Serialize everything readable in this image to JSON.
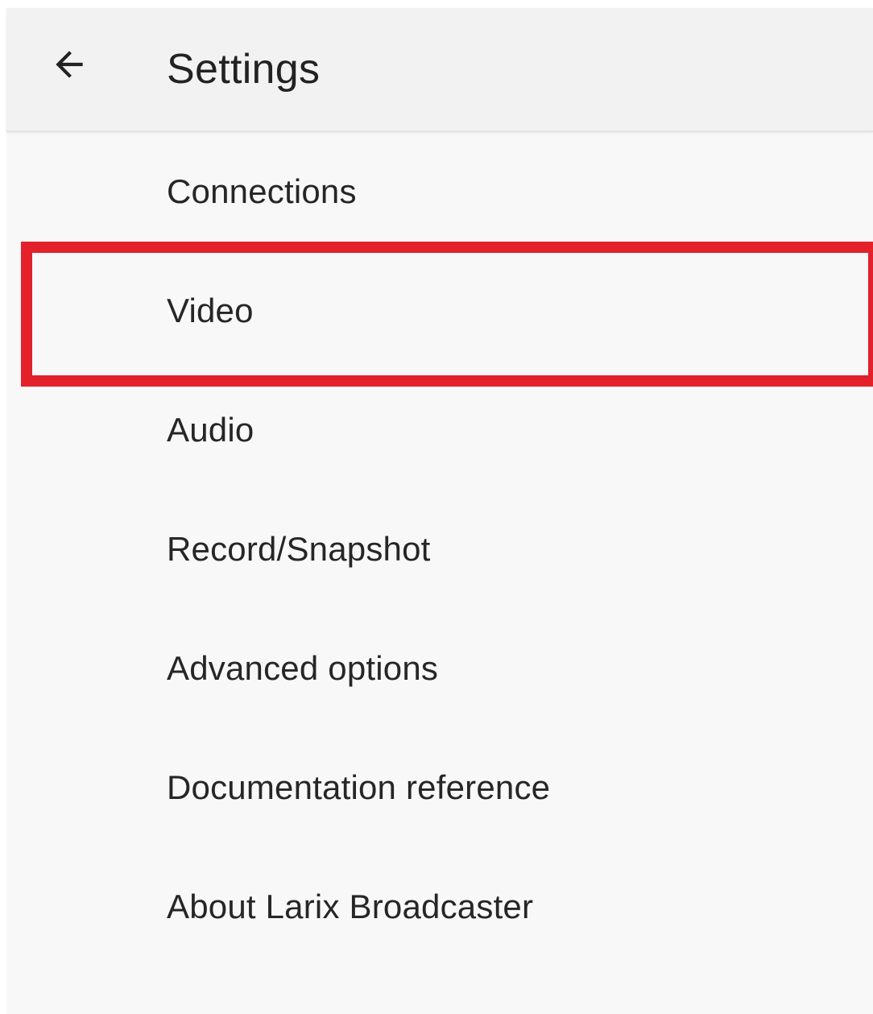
{
  "header": {
    "title": "Settings",
    "back_icon": "arrow-left-icon"
  },
  "menu": {
    "items": [
      {
        "label": "Connections"
      },
      {
        "label": "Video",
        "highlighted": true
      },
      {
        "label": "Audio"
      },
      {
        "label": "Record/Snapshot"
      },
      {
        "label": "Advanced options"
      },
      {
        "label": "Documentation reference"
      },
      {
        "label": "About Larix Broadcaster"
      }
    ]
  },
  "annotation": {
    "highlight_color": "#e3212b",
    "highlighted_item": "Video"
  },
  "colors": {
    "app_bar": "#f2f2f2",
    "background": "#f8f8f8",
    "text": "#262626"
  }
}
